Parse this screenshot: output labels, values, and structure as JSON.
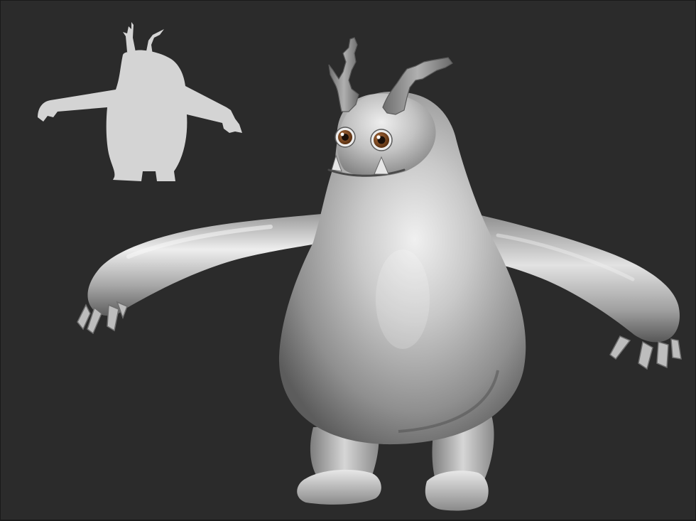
{
  "viewport": {
    "background_color": "#2b2b2b",
    "border_color": "#1a1a1a"
  },
  "silhouette_thumbnail": {
    "fill_color": "#d4d4d4",
    "icon": "model-silhouette-icon"
  },
  "model": {
    "subject": "monster",
    "material": "gray clay",
    "base_color": "#b9b9b9",
    "shadow_color": "#5a5a5a",
    "highlight_color": "#f2f2f2",
    "eye_color": "#7a4a22",
    "pupil_color": "#1a0f08",
    "antler_color": "#8e8e8e"
  }
}
